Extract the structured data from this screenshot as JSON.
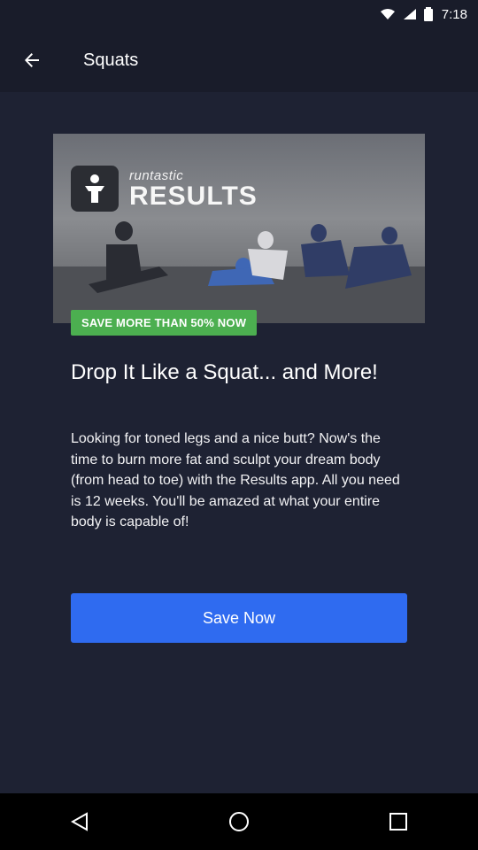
{
  "status_bar": {
    "time": "7:18"
  },
  "app_bar": {
    "title": "Squats"
  },
  "hero": {
    "brand_small": "runtastic",
    "brand_big": "RESULTS"
  },
  "promo_badge": "SAVE MORE THAN 50% NOW",
  "headline": "Drop It Like a Squat... and More!",
  "body_text": "Looking for toned legs and a nice butt? Now's the time to burn more fat and sculpt your dream body (from head to toe) with the Results app. All you need is 12 weeks. You'll be amazed at what your entire body is capable of!",
  "cta": {
    "label": "Save Now"
  },
  "colors": {
    "background": "#1e2233",
    "appbar": "#191c2a",
    "badge": "#4caf50",
    "button": "#2f6bf0"
  }
}
